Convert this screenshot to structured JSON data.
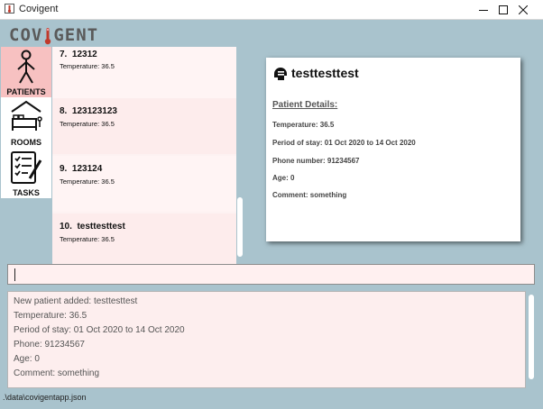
{
  "window": {
    "title": "Covigent"
  },
  "logo": {
    "text_left": "COV",
    "text_right": "GENT"
  },
  "sidebar": {
    "items": [
      {
        "label": "PATIENTS",
        "icon": "person-icon",
        "active": true
      },
      {
        "label": "ROOMS",
        "icon": "bed-icon",
        "active": false
      },
      {
        "label": "TASKS",
        "icon": "checklist-icon",
        "active": false
      }
    ]
  },
  "patients": [
    {
      "index": "7.",
      "name": "12312",
      "temperature": "Temperature: 36.5"
    },
    {
      "index": "8.",
      "name": "123123123",
      "temperature": "Temperature: 36.5"
    },
    {
      "index": "9.",
      "name": "123124",
      "temperature": "Temperature: 36.5"
    },
    {
      "index": "10.",
      "name": "testtesttest",
      "temperature": "Temperature: 36.5"
    }
  ],
  "details": {
    "icon": "patient-bust-icon",
    "name": "testtesttest",
    "section_title": "Patient Details:",
    "lines": [
      "Temperature: 36.5",
      "Period of stay: 01 Oct 2020 to 14 Oct 2020",
      "Phone number: 91234567",
      "Age: 0",
      "Comment: something"
    ]
  },
  "command": {
    "value": ""
  },
  "result": {
    "lines": [
      "New patient added: testtesttest",
      "Temperature: 36.5",
      "Period of stay: 01 Oct 2020 to 14 Oct 2020",
      "Phone: 91234567",
      "Age: 0",
      "Comment: something"
    ]
  },
  "status": {
    "path": ".\\data\\covigentapp.json"
  },
  "colors": {
    "background": "#a9c3cd",
    "active_nav": "#f7c1c1",
    "thermometer": "#c0392b"
  }
}
